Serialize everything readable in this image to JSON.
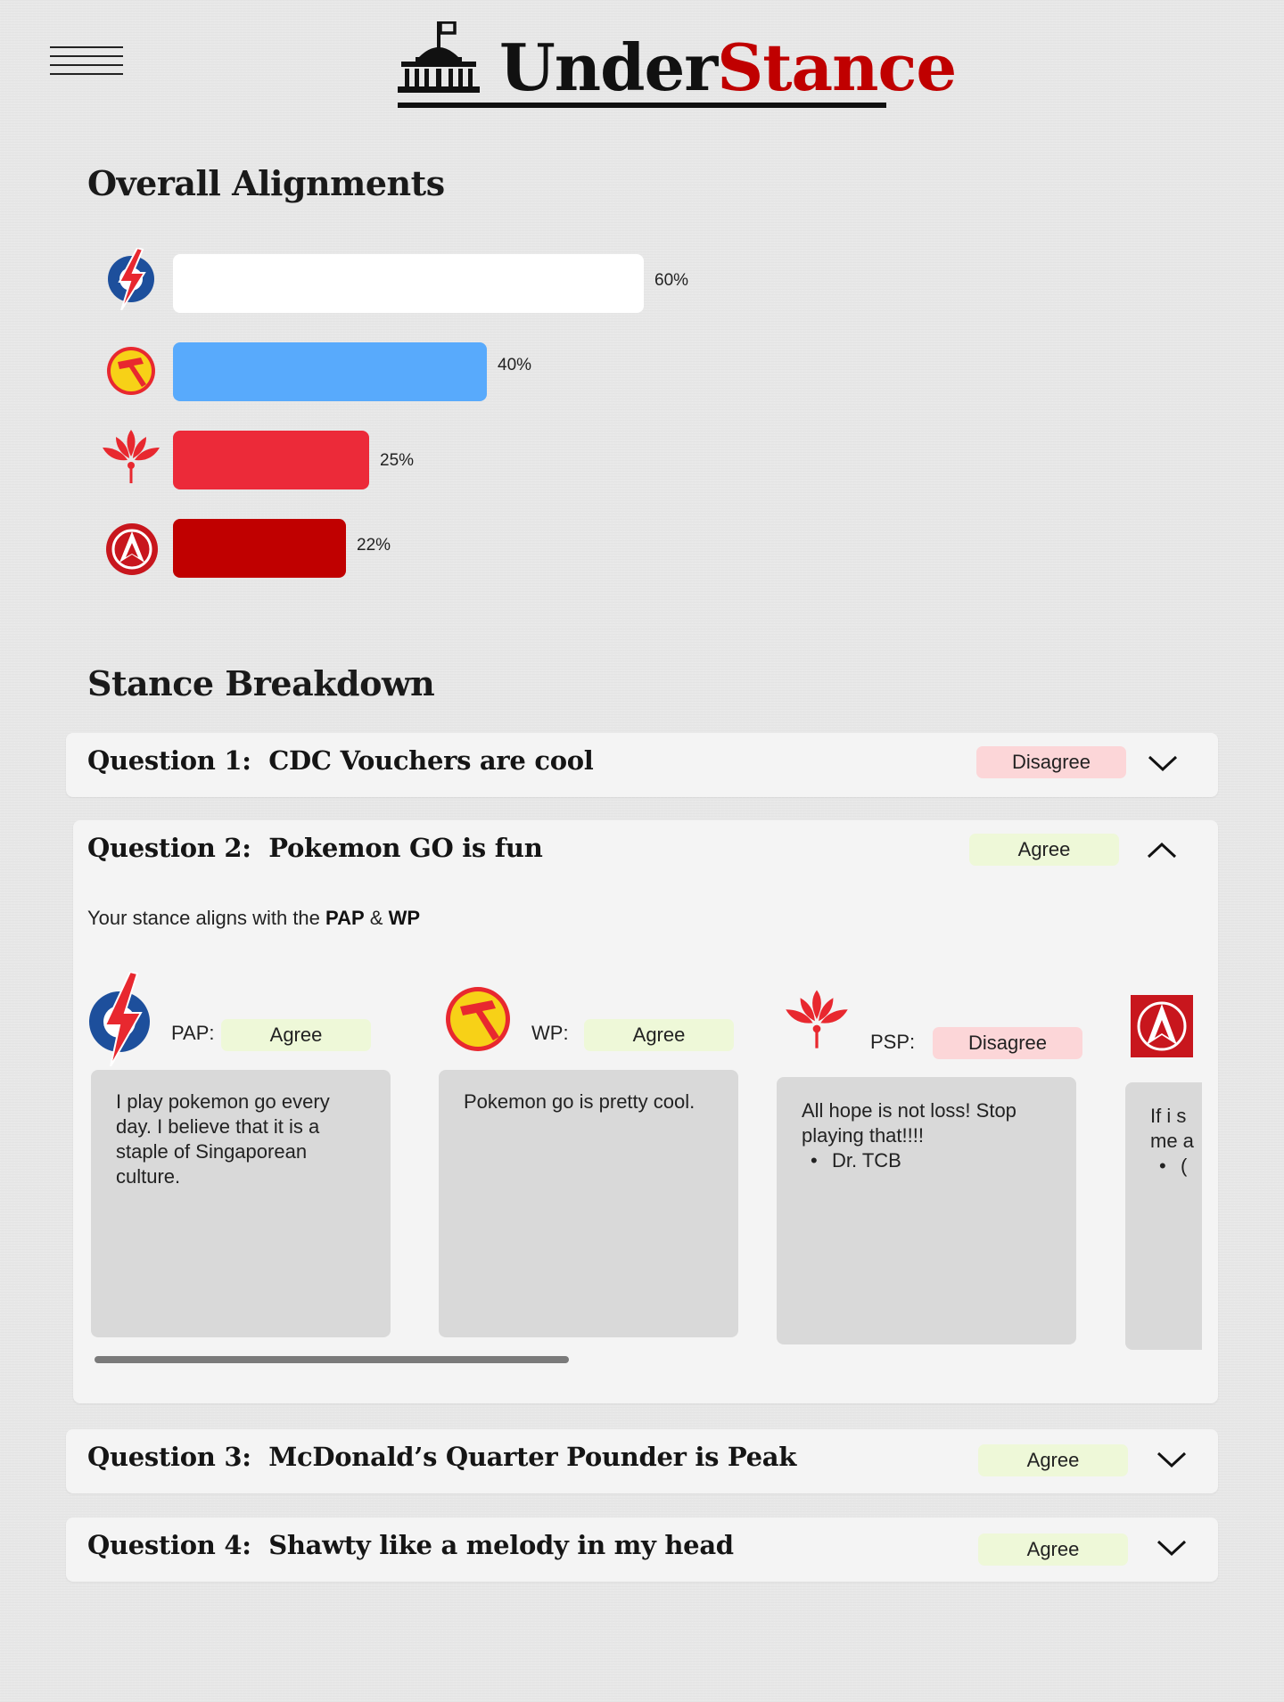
{
  "header": {
    "brand_part1": "Under",
    "brand_part2": "Stance",
    "menu_icon": "hamburger-menu-icon",
    "logo_icon": "parliament-building-icon"
  },
  "overall": {
    "title": "Overall Alignments",
    "chart_data": {
      "type": "bar",
      "orientation": "horizontal",
      "categories": [
        "PAP",
        "WP",
        "PSP",
        "SDA"
      ],
      "values": [
        60,
        40,
        25,
        22
      ],
      "value_labels": [
        "60%",
        "40%",
        "25%",
        "22%"
      ],
      "colors": [
        "#ffffff",
        "#58aafc",
        "#ec2a39",
        "#c00000"
      ],
      "xlim": [
        0,
        100
      ]
    }
  },
  "breakdown": {
    "title": "Stance Breakdown",
    "questions": [
      {
        "label": "Question 1:",
        "text": "CDC Vouchers are cool",
        "stance": "Disagree",
        "expanded": false
      },
      {
        "label": "Question 2:",
        "text": "Pokemon GO is fun",
        "stance": "Agree",
        "expanded": true,
        "align_prefix": "Your stance aligns with the",
        "align_party1": "PAP",
        "align_amp": "&",
        "align_party2": "WP",
        "parties": [
          {
            "name": "PAP:",
            "stance": "Agree",
            "comment": "I play pokemon go every day. I believe that it is a staple of Singaporean culture."
          },
          {
            "name": "WP:",
            "stance": "Agree",
            "comment": "Pokemon go is pretty cool."
          },
          {
            "name": "PSP:",
            "stance": "Disagree",
            "comment": "All hope is not loss! Stop playing that!!!!",
            "bullet": "Dr. TCB"
          },
          {
            "comment_partial_1": "If i s",
            "comment_partial_2": "me a",
            "bullet": "("
          }
        ]
      },
      {
        "label": "Question 3:",
        "text": "McDonald’s Quarter Pounder is Peak",
        "stance": "Agree",
        "expanded": false
      },
      {
        "label": "Question 4:",
        "text": "Shawty like a melody in my head",
        "stance": "Agree",
        "expanded": false
      }
    ]
  },
  "colors": {
    "brand_red": "#c00000",
    "agree_bg": "#eef8d8",
    "disagree_bg": "#fcd6d8",
    "card_bg": "#f4f4f4",
    "comment_bg": "#d9d9d9"
  }
}
